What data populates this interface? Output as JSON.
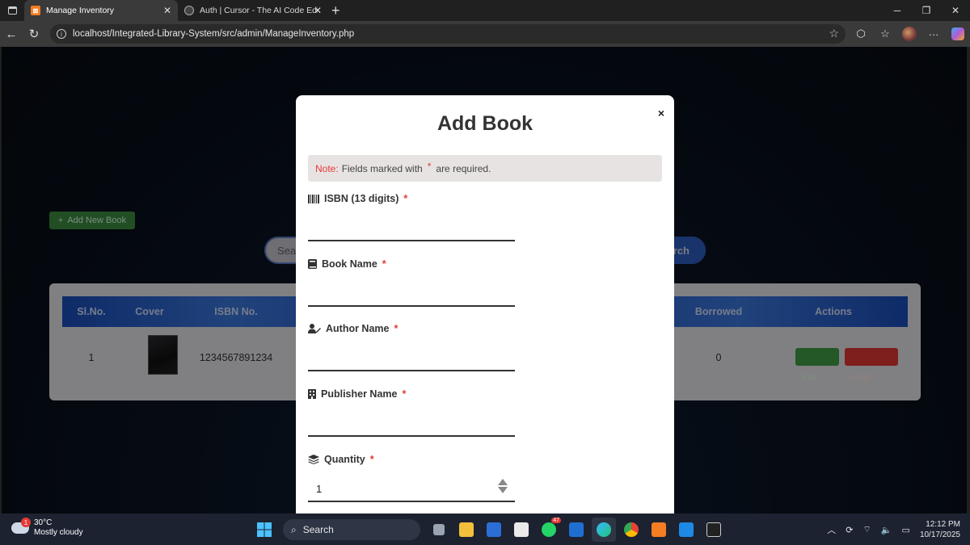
{
  "browser": {
    "tabs": [
      {
        "title": "Manage Inventory",
        "active": true
      },
      {
        "title": "Auth | Cursor - The AI Code Editor",
        "active": false
      }
    ],
    "url": "localhost/Integrated-Library-System/src/admin/ManageInventory.php"
  },
  "page": {
    "add_new_label": "Add New Book",
    "search_placeholder": "Sea",
    "search_button": "rch",
    "table": {
      "headers": [
        "Sl.No.",
        "Cover",
        "ISBN No.",
        "Borrowed",
        "Actions"
      ],
      "rows": [
        {
          "slno": "1",
          "isbn": "1234567891234",
          "borrowed": "0",
          "edit": "Edit",
          "delete": "Delete"
        }
      ]
    }
  },
  "modal": {
    "title": "Add Book",
    "close": "×",
    "note_label": "Note:",
    "note_text": "Fields marked with",
    "note_star": "*",
    "note_tail": "are required.",
    "fields": [
      {
        "label": "ISBN (13 digits)",
        "required": "*",
        "icon": "barcode-icon",
        "value": ""
      },
      {
        "label": "Book Name",
        "required": "*",
        "icon": "book-icon",
        "value": ""
      },
      {
        "label": "Author Name",
        "required": "*",
        "icon": "user-pen-icon",
        "value": ""
      },
      {
        "label": "Publisher Name",
        "required": "*",
        "icon": "building-icon",
        "value": ""
      },
      {
        "label": "Quantity",
        "required": "*",
        "icon": "layers-icon",
        "value": "1"
      }
    ]
  },
  "taskbar": {
    "weather_temp": "30°C",
    "weather_desc": "Mostly cloudy",
    "weather_badge": "1",
    "search_label": "Search",
    "whatsapp_badge": "47",
    "time": "12:12 PM",
    "date": "10/17/2025"
  }
}
